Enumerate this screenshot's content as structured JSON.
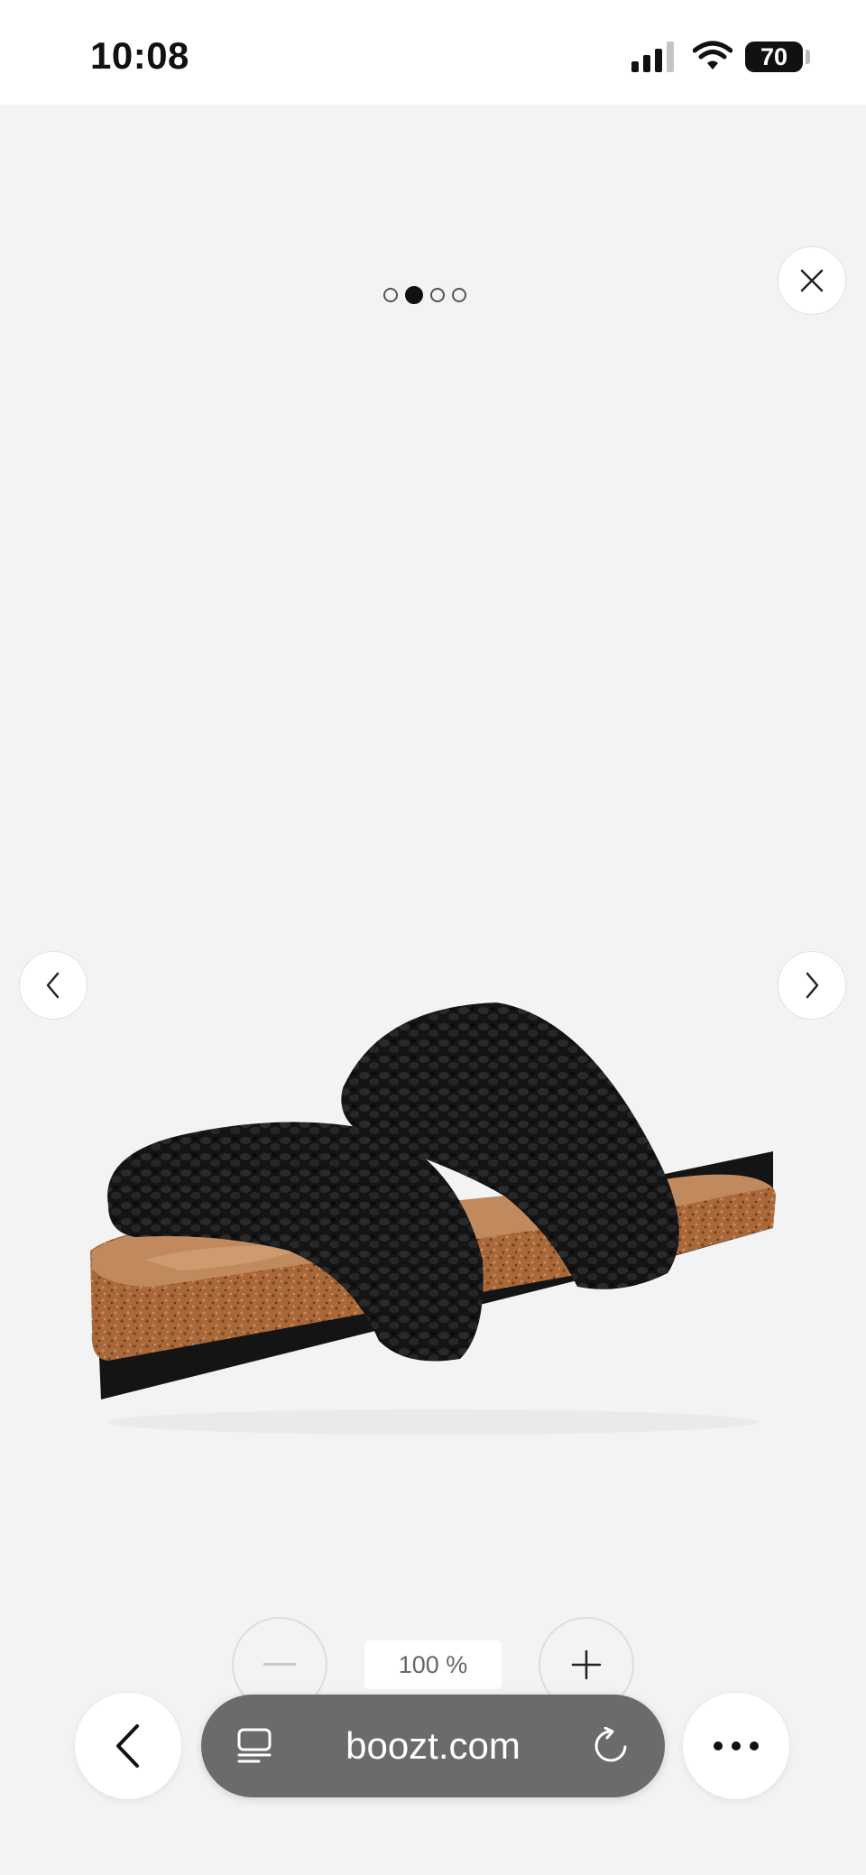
{
  "status_bar": {
    "time": "10:08",
    "battery_level": "70",
    "signal_icon": "cellular-signal-icon",
    "wifi_icon": "wifi-icon"
  },
  "gallery": {
    "total_images": 4,
    "active_index": 1,
    "product_image": "black crochet double-strap sandal with cork footbed",
    "close_icon": "close-icon",
    "prev_icon": "chevron-left-icon",
    "next_icon": "chevron-right-icon"
  },
  "zoom": {
    "level_label": "100 %",
    "zoom_out_icon": "minus-icon",
    "zoom_in_icon": "plus-icon"
  },
  "browser_toolbar": {
    "url": "boozt.com",
    "back_icon": "back-chevron-icon",
    "tabs_icon": "tabs-icon",
    "reload_icon": "reload-icon",
    "more_icon": "more-icon"
  },
  "colors": {
    "background": "#f3f3f3",
    "url_bar": "#6b6b6b",
    "active_dot": "#111111"
  }
}
